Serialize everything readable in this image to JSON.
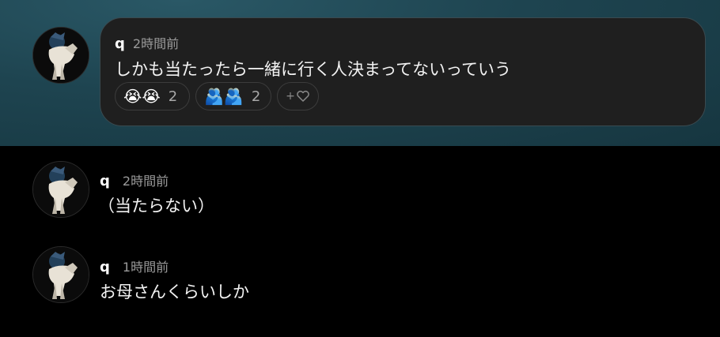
{
  "comments": [
    {
      "name": "q",
      "time": "2時間前",
      "text": "しかも当たったら一緒に行く人決まってないっていう",
      "reactions": [
        {
          "emoji": "😭😭",
          "count": "2"
        },
        {
          "emoji": "🫂🫂",
          "count": "2"
        }
      ],
      "add_reaction_label": "+"
    },
    {
      "name": "q",
      "time": "2時間前",
      "text": "（当たらない）"
    },
    {
      "name": "q",
      "time": "1時間前",
      "text": "お母さんくらいしか"
    }
  ],
  "colors": {
    "highlight_bg": "#1e4450",
    "bubble_bg": "#1f1f1f",
    "page_bg": "#000000",
    "time_text": "#9a9a9a"
  },
  "icons": [
    "avatar-figure",
    "heart-icon"
  ]
}
